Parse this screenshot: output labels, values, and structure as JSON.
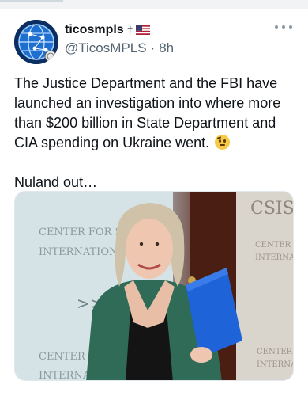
{
  "tweet": {
    "display_name": "ticosmpls",
    "name_glyph": "†",
    "handle": "@TicosMPLS",
    "separator": "·",
    "time": "8h",
    "body_line1": "The Justice Department and the FBI have launched an investigation into where more than $200 billion in State Department and CIA spending on Ukraine went.",
    "body_line2": "Nuland out…",
    "emoji": "raised-eyebrow-face",
    "media": {
      "signage_top": "CENTER FOR STRA",
      "signage_mid": "INTERNATIONAL",
      "signage_right_top": "CSIS",
      "signage_right": "CENTER",
      "signage_right2": "INTERNA",
      "signage_bottom_left": "CENTER F",
      "signage_bottom_left2": "INTERNAT",
      "signage_bottom_right": "CENTER",
      "signage_bottom_right2": "INTERNA",
      "arrows": ">>"
    }
  },
  "colors": {
    "text_primary": "#0f1419",
    "text_secondary": "#536471",
    "folder_blue": "#1f63d8",
    "jacket_green": "#2f6b57"
  },
  "icons": {
    "more": "more-horizontal-icon",
    "flag": "us-flag-icon",
    "avatar": "globe-avatar"
  }
}
